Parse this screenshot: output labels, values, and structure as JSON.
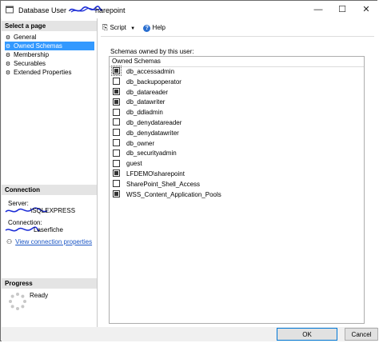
{
  "window": {
    "title_prefix": "Database User - ",
    "title_suffix": "harepoint",
    "minimize_label": "—",
    "maximize_label": "☐",
    "close_label": "✕"
  },
  "left": {
    "select_page_header": "Select a page",
    "pages": [
      {
        "label": "General",
        "active": false
      },
      {
        "label": "Owned Schemas",
        "active": true
      },
      {
        "label": "Membership",
        "active": false
      },
      {
        "label": "Securables",
        "active": false
      },
      {
        "label": "Extended Properties",
        "active": false
      }
    ],
    "connection_header": "Connection",
    "server_label": "Server:",
    "server_value": "\\SQLEXPRESS",
    "connection_label": "Connection:",
    "connection_value": "Laserfiche",
    "view_connection_link": "View connection properties",
    "progress_header": "Progress",
    "progress_status": "Ready"
  },
  "toolbar": {
    "script_label": "Script",
    "help_label": "Help"
  },
  "schemas": {
    "panel_label": "Schemas owned by this user:",
    "column_header": "Owned Schemas",
    "items": [
      {
        "name": "db_accessadmin",
        "checked": true
      },
      {
        "name": "db_backupoperator",
        "checked": false
      },
      {
        "name": "db_datareader",
        "checked": true
      },
      {
        "name": "db_datawriter",
        "checked": true
      },
      {
        "name": "db_ddladmin",
        "checked": false
      },
      {
        "name": "db_denydatareader",
        "checked": false
      },
      {
        "name": "db_denydatawriter",
        "checked": false
      },
      {
        "name": "db_owner",
        "checked": false
      },
      {
        "name": "db_securityadmin",
        "checked": false
      },
      {
        "name": "guest",
        "checked": false
      },
      {
        "name": "LFDEMO\\sharepoint",
        "checked": true
      },
      {
        "name": "SharePoint_Shell_Access",
        "checked": false
      },
      {
        "name": "WSS_Content_Application_Pools",
        "checked": true
      }
    ]
  },
  "buttons": {
    "ok_label": "OK",
    "cancel_label": "Cancel"
  }
}
